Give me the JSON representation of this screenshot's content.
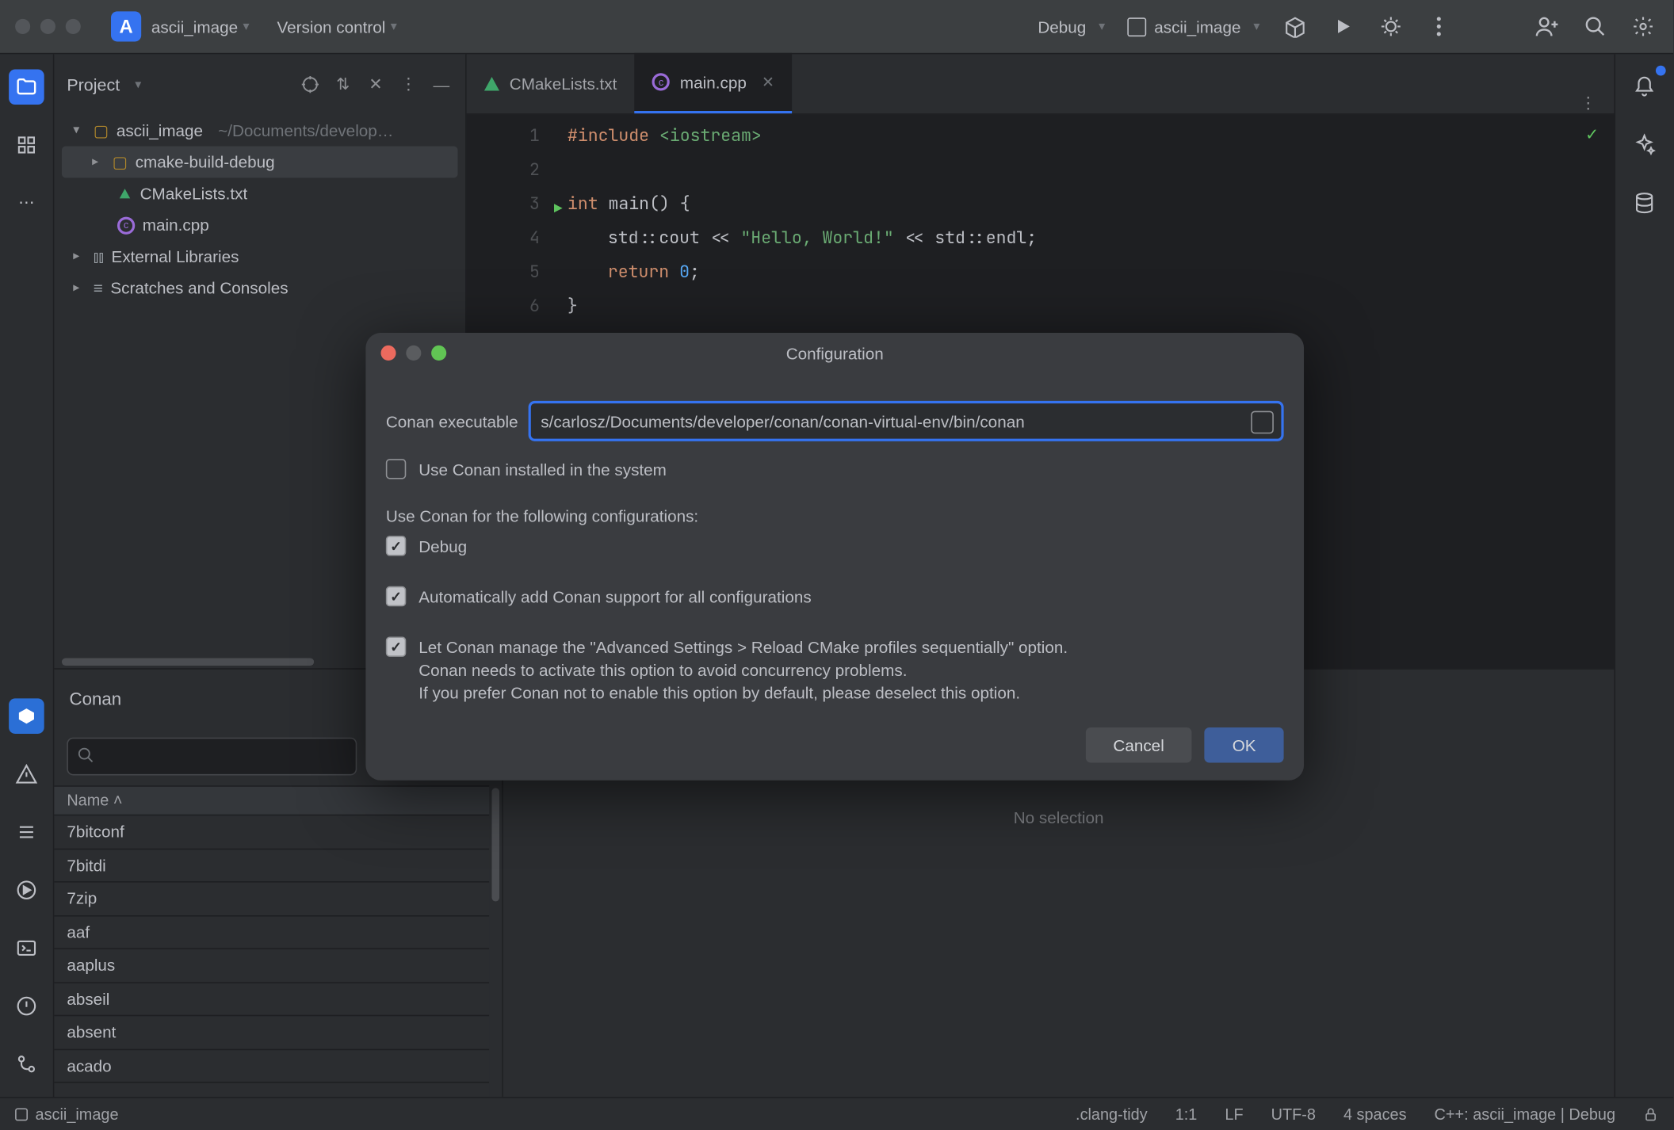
{
  "titlebar": {
    "project_initial": "A",
    "project_name": "ascii_image",
    "version_control": "Version control",
    "run_config": "Debug",
    "run_target": "ascii_image"
  },
  "project_tool": {
    "title": "Project",
    "root": "ascii_image",
    "root_path": "~/Documents/develop…",
    "build_dir": "cmake-build-debug",
    "cmake_file": "CMakeLists.txt",
    "main_file": "main.cpp",
    "external": "External Libraries",
    "scratches": "Scratches and Consoles"
  },
  "tabs": {
    "cmake": "CMakeLists.txt",
    "main": "main.cpp"
  },
  "code": {
    "lines": [
      "1",
      "2",
      "3",
      "4",
      "5",
      "6"
    ],
    "l1a": "#include",
    "l1b": "<iostream>",
    "l3a": "int",
    "l3b": "main",
    "l3c": "() {",
    "l4a": "std",
    "l4b": "::",
    "l4c": "cout",
    "l4d": " << ",
    "l4e": "\"Hello, World!\"",
    "l4f": " << ",
    "l4g": "std",
    "l4h": "::",
    "l4i": "endl",
    "l4j": ";",
    "l5a": "return",
    "l5b": "0",
    "l5c": ";",
    "l6": "}"
  },
  "conan": {
    "title": "Conan",
    "name_col": "Name",
    "packages": [
      "7bitconf",
      "7bitdi",
      "7zip",
      "aaf",
      "aaplus",
      "abseil",
      "absent",
      "acado"
    ],
    "no_selection": "No selection"
  },
  "statusbar": {
    "project": "ascii_image",
    "clang": ".clang-tidy",
    "pos": "1:1",
    "eol": "LF",
    "enc": "UTF-8",
    "indent": "4 spaces",
    "ctx": "C++: ascii_image | Debug"
  },
  "dialog": {
    "title": "Configuration",
    "exe_label": "Conan executable",
    "exe_value": "s/carlosz/Documents/developer/conan/conan-virtual-env/bin/conan",
    "use_system": "Use Conan installed in the system",
    "configs_label": "Use Conan for the following configurations:",
    "cfg_debug": "Debug",
    "auto_add": "Automatically add Conan support for all configurations",
    "advanced1": "Let Conan manage the \"Advanced Settings > Reload CMake profiles sequentially\" option.",
    "advanced2": "Conan needs to activate this option to avoid concurrency problems.",
    "advanced3": "If you prefer Conan not to enable this option by default, please deselect this option.",
    "cancel": "Cancel",
    "ok": "OK"
  }
}
